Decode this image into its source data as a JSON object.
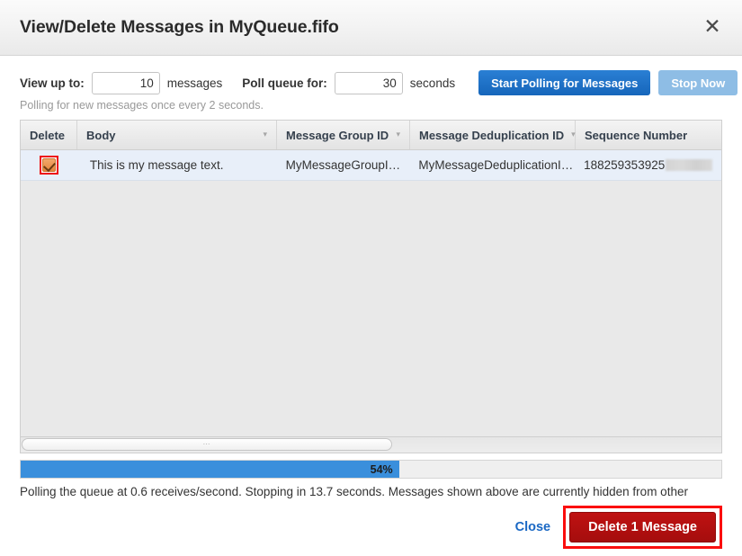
{
  "dialog": {
    "title": "View/Delete Messages in MyQueue.fifo",
    "close_icon": "close-icon"
  },
  "controls": {
    "view_label": "View up to:",
    "view_value": "10",
    "view_unit": "messages",
    "poll_label": "Poll queue for:",
    "poll_value": "30",
    "poll_unit": "seconds",
    "start_button": "Start Polling for Messages",
    "stop_button": "Stop Now",
    "note": "Polling for new messages once every 2 seconds."
  },
  "table": {
    "columns": [
      {
        "label": "Delete",
        "sortable": false
      },
      {
        "label": "Body",
        "sortable": true
      },
      {
        "label": "Message Group ID",
        "sortable": true
      },
      {
        "label": "Message Deduplication ID",
        "sortable": true
      },
      {
        "label": "Sequence Number",
        "sortable": false
      }
    ],
    "rows": [
      {
        "selected": true,
        "body": "This is my message text.",
        "group_id": "MyMessageGroupI…",
        "dedup_id": "MyMessageDeduplicationI…",
        "sequence_number": "188259353925"
      }
    ],
    "caret_glyph": "▾",
    "scroll_grip": "⋯"
  },
  "progress": {
    "percent_label": "54%",
    "percent_value": 54
  },
  "status": {
    "text": "Polling the queue at 0.6 receives/second. Stopping in 13.7 seconds. Messages shown above are currently hidden from other"
  },
  "footer": {
    "close_label": "Close",
    "delete_label": "Delete 1 Message"
  },
  "colors": {
    "primary_blue": "#1666bb",
    "disabled_blue": "#8ebde5",
    "progress_blue": "#3a8fdc",
    "danger_red": "#a50d0d",
    "annotation_red": "#fb0d0d",
    "link_blue": "#1a68c4",
    "checkbox_orange": "#e4863c",
    "row_selected": "#e8eff9"
  }
}
